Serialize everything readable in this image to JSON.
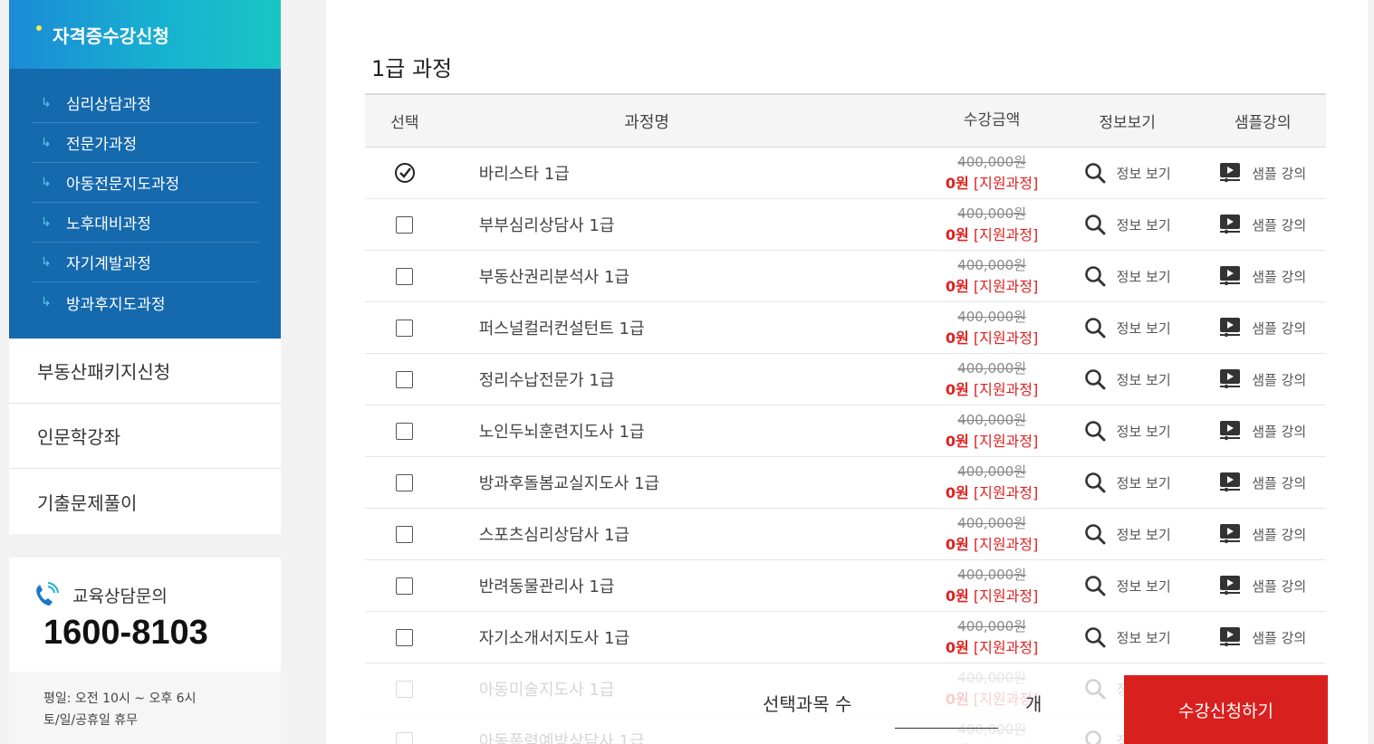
{
  "sidebar": {
    "head": "자격증수강신청",
    "sub_items": [
      {
        "label": "심리상담과정"
      },
      {
        "label": "전문가과정"
      },
      {
        "label": "아동전문지도과정"
      },
      {
        "label": "노후대비과정"
      },
      {
        "label": "자기계발과정"
      },
      {
        "label": "방과후지도과정"
      }
    ],
    "menu": [
      {
        "label": "부동산패키지신청"
      },
      {
        "label": "인문학강좌"
      },
      {
        "label": "기출문제풀이"
      }
    ],
    "contact": {
      "label": "교육상담문의",
      "phone": "1600-8103",
      "hours_weekday": "평일: 오전 10시 ~ 오후 6시",
      "hours_off": "토/일/공휴일 휴무"
    }
  },
  "main": {
    "title": "1급 과정",
    "headers": {
      "select": "선택",
      "name": "과정명",
      "price": "수강금액",
      "info": "정보보기",
      "sample": "샘플강의"
    },
    "price_original": "400,000원",
    "price_sale": "0원",
    "price_tag": "[지원과정]",
    "info_label": "정보 보기",
    "sample_label": "샘플 강의",
    "courses": [
      {
        "name": "바리스타 1급",
        "checked": true
      },
      {
        "name": "부부심리상담사 1급",
        "checked": false
      },
      {
        "name": "부동산권리분석사 1급",
        "checked": false
      },
      {
        "name": "퍼스널컬러컨설턴트 1급",
        "checked": false
      },
      {
        "name": "정리수납전문가 1급",
        "checked": false
      },
      {
        "name": "노인두뇌훈련지도사 1급",
        "checked": false
      },
      {
        "name": "방과후돌봄교실지도사 1급",
        "checked": false
      },
      {
        "name": "스포츠심리상담사 1급",
        "checked": false
      },
      {
        "name": "반려동물관리사 1급",
        "checked": false
      },
      {
        "name": "자기소개서지도사 1급",
        "checked": false
      },
      {
        "name": "아동미술지도사 1급",
        "checked": false
      },
      {
        "name": "아동폭력예방상담사 1급",
        "checked": false
      }
    ]
  },
  "bottom": {
    "count_label": "선택과목 수",
    "count_unit": "개",
    "apply": "수강신청하기"
  },
  "colors": {
    "primary": "#1569ad",
    "accent": "#d8201f",
    "sale": "#e02020"
  }
}
